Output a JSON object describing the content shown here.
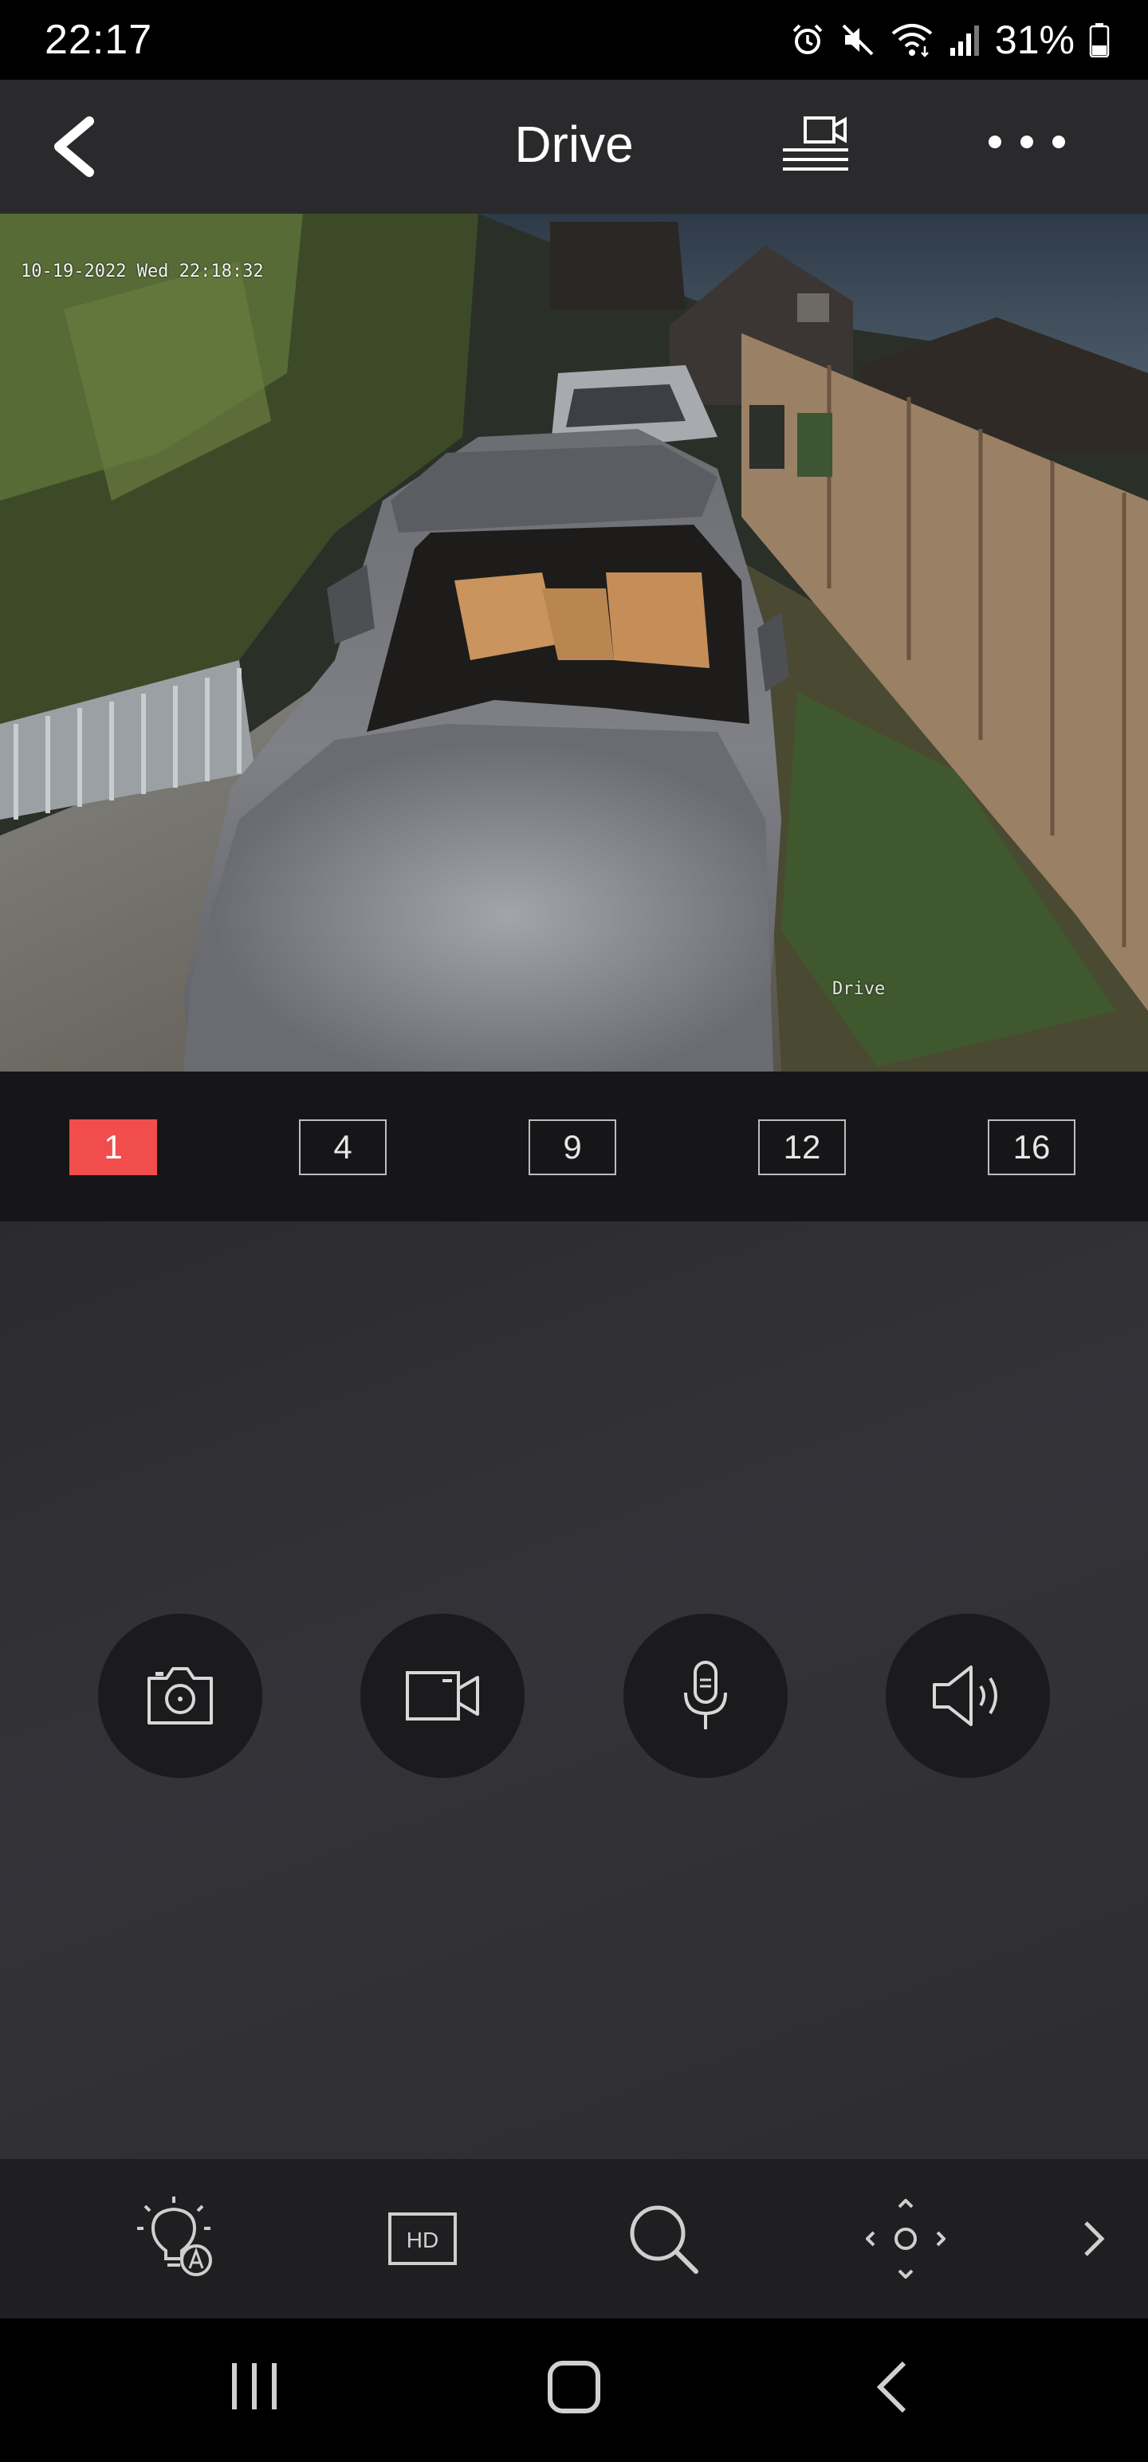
{
  "status_bar": {
    "time": "22:17",
    "battery": "31%",
    "icons": [
      "alarm-icon",
      "mute-icon",
      "wifi-icon",
      "signal-icon",
      "battery-icon"
    ]
  },
  "app_bar": {
    "title": "Drive",
    "back_icon": "chevron-left-icon",
    "record_icon": "screen-record-icon",
    "more_icon": "more-horizontal-icon"
  },
  "video": {
    "osd_timestamp": "10-19-2022 Wed 22:18:32",
    "osd_camera_name": "Drive"
  },
  "layout_options": [
    {
      "label": "1",
      "active": true
    },
    {
      "label": "4",
      "active": false
    },
    {
      "label": "9",
      "active": false
    },
    {
      "label": "12",
      "active": false
    },
    {
      "label": "16",
      "active": false
    }
  ],
  "controls": [
    "camera-icon",
    "video-record-icon",
    "microphone-icon",
    "speaker-icon"
  ],
  "toolbar": [
    "auto-light-icon",
    "hd-icon",
    "zoom-icon",
    "ptz-icon",
    "chevron-right-icon"
  ],
  "colors": {
    "accent": "#f24d4d",
    "app_bar": "#2a2a2c",
    "panel": "#333338"
  }
}
